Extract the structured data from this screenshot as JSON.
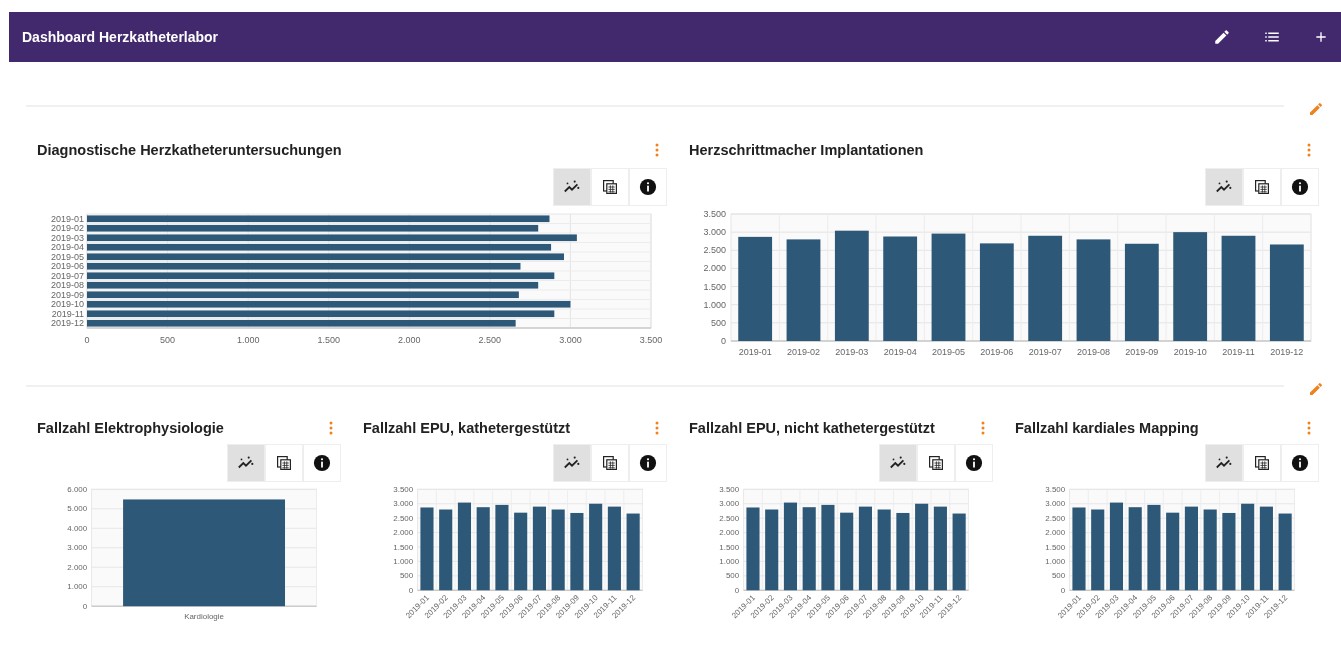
{
  "header": {
    "title": "Dashboard Herzkatheterlabor"
  },
  "sections": [
    {
      "widgets": [
        {
          "title": "Diagnostische Herzkatheteruntersuchungen",
          "toolbar": [
            {
              "kind": "chart",
              "selected": true
            },
            {
              "kind": "table",
              "selected": false
            },
            {
              "kind": "info",
              "selected": false
            }
          ],
          "chart_data": {
            "type": "bar",
            "orientation": "horizontal",
            "categories": [
              "2019-01",
              "2019-02",
              "2019-03",
              "2019-04",
              "2019-05",
              "2019-06",
              "2019-07",
              "2019-08",
              "2019-09",
              "2019-10",
              "2019-11",
              "2019-12"
            ],
            "grid": true,
            "series": [
              {
                "color": "#2e5878",
                "values": [
                  2870,
                  2800,
                  3040,
                  2880,
                  2960,
                  2690,
                  2900,
                  2800,
                  2680,
                  3000,
                  2900,
                  2660
                ]
              }
            ],
            "xlim": [
              0,
              3500
            ],
            "xticks": [
              {
                "value": 0,
                "label": "0"
              },
              {
                "value": 500,
                "label": "500"
              },
              {
                "value": 1000,
                "label": "1.000"
              },
              {
                "value": 1500,
                "label": "1.500"
              },
              {
                "value": 2000,
                "label": "2.000"
              },
              {
                "value": 2500,
                "label": "2.500"
              },
              {
                "value": 3000,
                "label": "3.000"
              },
              {
                "value": 3500,
                "label": "3.500"
              }
            ]
          }
        },
        {
          "title": "Herzschrittmacher Implantationen",
          "toolbar": [
            {
              "kind": "chart",
              "selected": true
            },
            {
              "kind": "table",
              "selected": false
            },
            {
              "kind": "info",
              "selected": false
            }
          ],
          "chart_data": {
            "type": "bar",
            "orientation": "vertical",
            "categories": [
              "2019-01",
              "2019-02",
              "2019-03",
              "2019-04",
              "2019-05",
              "2019-06",
              "2019-07",
              "2019-08",
              "2019-09",
              "2019-10",
              "2019-11",
              "2019-12"
            ],
            "grid": true,
            "series": [
              {
                "color": "#2e5878",
                "values": [
                  2870,
                  2800,
                  3040,
                  2880,
                  2960,
                  2690,
                  2900,
                  2800,
                  2680,
                  3000,
                  2900,
                  2660
                ]
              }
            ],
            "ylim": [
              0,
              3500
            ],
            "yticks": [
              {
                "value": 0,
                "label": "0"
              },
              {
                "value": 500,
                "label": "500"
              },
              {
                "value": 1000,
                "label": "1.000"
              },
              {
                "value": 1500,
                "label": "1.500"
              },
              {
                "value": 2000,
                "label": "2.000"
              },
              {
                "value": 2500,
                "label": "2.500"
              },
              {
                "value": 3000,
                "label": "3.000"
              },
              {
                "value": 3500,
                "label": "3.500"
              }
            ]
          }
        }
      ]
    },
    {
      "widgets": [
        {
          "title": "Fallzahl Elektrophysiologie",
          "toolbar": [
            {
              "kind": "chart",
              "selected": true
            },
            {
              "kind": "table",
              "selected": false
            },
            {
              "kind": "info",
              "selected": false
            }
          ],
          "chart_data": {
            "type": "bar",
            "orientation": "vertical",
            "categories": [
              "Kardiologie"
            ],
            "grid": true,
            "series": [
              {
                "color": "#2e5878",
                "values": [
                  5480
                ]
              }
            ],
            "ylim": [
              0,
              6000
            ],
            "yticks": [
              {
                "value": 0,
                "label": "0"
              },
              {
                "value": 1000,
                "label": "1.000"
              },
              {
                "value": 2000,
                "label": "2.000"
              },
              {
                "value": 3000,
                "label": "3.000"
              },
              {
                "value": 4000,
                "label": "4.000"
              },
              {
                "value": 5000,
                "label": "5.000"
              },
              {
                "value": 6000,
                "label": "6.000"
              }
            ]
          }
        },
        {
          "title": "Fallzahl EPU, kathetergestützt",
          "toolbar": [
            {
              "kind": "chart",
              "selected": true
            },
            {
              "kind": "table",
              "selected": false
            },
            {
              "kind": "info",
              "selected": false
            }
          ],
          "chart_data": {
            "type": "bar",
            "orientation": "vertical",
            "categories": [
              "2019-01",
              "2019-02",
              "2019-03",
              "2019-04",
              "2019-05",
              "2019-06",
              "2019-07",
              "2019-08",
              "2019-09",
              "2019-10",
              "2019-11",
              "2019-12"
            ],
            "grid": true,
            "series": [
              {
                "color": "#2e5878",
                "values": [
                  2870,
                  2800,
                  3040,
                  2880,
                  2960,
                  2690,
                  2900,
                  2800,
                  2680,
                  3000,
                  2900,
                  2660
                ]
              }
            ],
            "ylim": [
              0,
              3500
            ],
            "yticks": [
              {
                "value": 0,
                "label": "0"
              },
              {
                "value": 500,
                "label": "500"
              },
              {
                "value": 1000,
                "label": "1.000"
              },
              {
                "value": 1500,
                "label": "1.500"
              },
              {
                "value": 2000,
                "label": "2.000"
              },
              {
                "value": 2500,
                "label": "2.500"
              },
              {
                "value": 3000,
                "label": "3.000"
              },
              {
                "value": 3500,
                "label": "3.500"
              }
            ]
          }
        },
        {
          "title": "Fallzahl EPU, nicht kathetergestützt",
          "toolbar": [
            {
              "kind": "chart",
              "selected": true
            },
            {
              "kind": "table",
              "selected": false
            },
            {
              "kind": "info",
              "selected": false
            }
          ],
          "chart_data": {
            "type": "bar",
            "orientation": "vertical",
            "categories": [
              "2019-01",
              "2019-02",
              "2019-03",
              "2019-04",
              "2019-05",
              "2019-06",
              "2019-07",
              "2019-08",
              "2019-09",
              "2019-10",
              "2019-11",
              "2019-12"
            ],
            "grid": true,
            "series": [
              {
                "color": "#2e5878",
                "values": [
                  2870,
                  2800,
                  3040,
                  2880,
                  2960,
                  2690,
                  2900,
                  2800,
                  2680,
                  3000,
                  2900,
                  2660
                ]
              }
            ],
            "ylim": [
              0,
              3500
            ],
            "yticks": [
              {
                "value": 0,
                "label": "0"
              },
              {
                "value": 500,
                "label": "500"
              },
              {
                "value": 1000,
                "label": "1.000"
              },
              {
                "value": 1500,
                "label": "1.500"
              },
              {
                "value": 2000,
                "label": "2.000"
              },
              {
                "value": 2500,
                "label": "2.500"
              },
              {
                "value": 3000,
                "label": "3.000"
              },
              {
                "value": 3500,
                "label": "3.500"
              }
            ]
          }
        },
        {
          "title": "Fallzahl kardiales Mapping",
          "toolbar": [
            {
              "kind": "chart",
              "selected": true
            },
            {
              "kind": "table",
              "selected": false
            },
            {
              "kind": "info",
              "selected": false
            }
          ],
          "chart_data": {
            "type": "bar",
            "orientation": "vertical",
            "categories": [
              "2019-01",
              "2019-02",
              "2019-03",
              "2019-04",
              "2019-05",
              "2019-06",
              "2019-07",
              "2019-08",
              "2019-09",
              "2019-10",
              "2019-11",
              "2019-12"
            ],
            "grid": true,
            "series": [
              {
                "color": "#2e5878",
                "values": [
                  2870,
                  2800,
                  3040,
                  2880,
                  2960,
                  2690,
                  2900,
                  2800,
                  2680,
                  3000,
                  2900,
                  2660
                ]
              }
            ],
            "ylim": [
              0,
              3500
            ],
            "yticks": [
              {
                "value": 0,
                "label": "0"
              },
              {
                "value": 500,
                "label": "500"
              },
              {
                "value": 1000,
                "label": "1.000"
              },
              {
                "value": 1500,
                "label": "1.500"
              },
              {
                "value": 2000,
                "label": "2.000"
              },
              {
                "value": 2500,
                "label": "2.500"
              },
              {
                "value": 3000,
                "label": "3.000"
              },
              {
                "value": 3500,
                "label": "3.500"
              }
            ]
          }
        }
      ]
    }
  ]
}
